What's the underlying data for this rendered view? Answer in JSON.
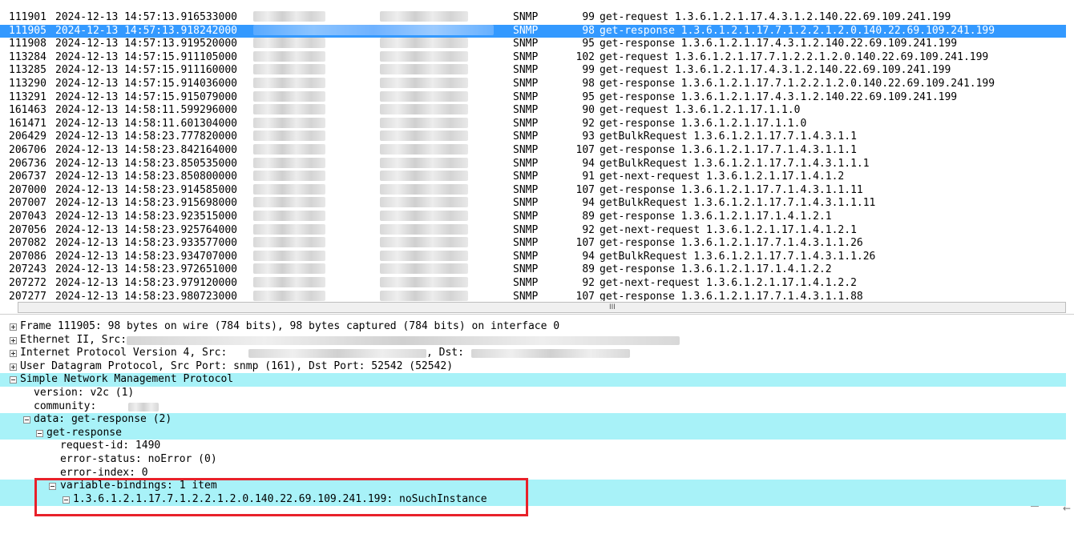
{
  "packets": [
    {
      "no": "111901",
      "time": "2024-12-13 14:57:13.916533000",
      "protocol": "SNMP",
      "length": "99",
      "info": "get-request 1.3.6.1.2.1.17.4.3.1.2.140.22.69.109.241.199"
    },
    {
      "no": "111905",
      "time": "2024-12-13 14:57:13.918242000",
      "protocol": "SNMP",
      "length": "98",
      "info": "get-response 1.3.6.1.2.1.17.7.1.2.2.1.2.0.140.22.69.109.241.199",
      "selected": true
    },
    {
      "no": "111908",
      "time": "2024-12-13 14:57:13.919520000",
      "protocol": "SNMP",
      "length": "95",
      "info": "get-response 1.3.6.1.2.1.17.4.3.1.2.140.22.69.109.241.199"
    },
    {
      "no": "113284",
      "time": "2024-12-13 14:57:15.911105000",
      "protocol": "SNMP",
      "length": "102",
      "info": "get-request 1.3.6.1.2.1.17.7.1.2.2.1.2.0.140.22.69.109.241.199"
    },
    {
      "no": "113285",
      "time": "2024-12-13 14:57:15.911160000",
      "protocol": "SNMP",
      "length": "99",
      "info": "get-request 1.3.6.1.2.1.17.4.3.1.2.140.22.69.109.241.199"
    },
    {
      "no": "113290",
      "time": "2024-12-13 14:57:15.914036000",
      "protocol": "SNMP",
      "length": "98",
      "info": "get-response 1.3.6.1.2.1.17.7.1.2.2.1.2.0.140.22.69.109.241.199"
    },
    {
      "no": "113291",
      "time": "2024-12-13 14:57:15.915079000",
      "protocol": "SNMP",
      "length": "95",
      "info": "get-response 1.3.6.1.2.1.17.4.3.1.2.140.22.69.109.241.199"
    },
    {
      "no": "161463",
      "time": "2024-12-13 14:58:11.599296000",
      "protocol": "SNMP",
      "length": "90",
      "info": "get-request 1.3.6.1.2.1.17.1.1.0"
    },
    {
      "no": "161471",
      "time": "2024-12-13 14:58:11.601304000",
      "protocol": "SNMP",
      "length": "92",
      "info": "get-response 1.3.6.1.2.1.17.1.1.0"
    },
    {
      "no": "206429",
      "time": "2024-12-13 14:58:23.777820000",
      "protocol": "SNMP",
      "length": "93",
      "info": "getBulkRequest 1.3.6.1.2.1.17.7.1.4.3.1.1"
    },
    {
      "no": "206706",
      "time": "2024-12-13 14:58:23.842164000",
      "protocol": "SNMP",
      "length": "107",
      "info": "get-response 1.3.6.1.2.1.17.7.1.4.3.1.1.1"
    },
    {
      "no": "206736",
      "time": "2024-12-13 14:58:23.850535000",
      "protocol": "SNMP",
      "length": "94",
      "info": "getBulkRequest 1.3.6.1.2.1.17.7.1.4.3.1.1.1"
    },
    {
      "no": "206737",
      "time": "2024-12-13 14:58:23.850800000",
      "protocol": "SNMP",
      "length": "91",
      "info": "get-next-request 1.3.6.1.2.1.17.1.4.1.2"
    },
    {
      "no": "207000",
      "time": "2024-12-13 14:58:23.914585000",
      "protocol": "SNMP",
      "length": "107",
      "info": "get-response 1.3.6.1.2.1.17.7.1.4.3.1.1.11"
    },
    {
      "no": "207007",
      "time": "2024-12-13 14:58:23.915698000",
      "protocol": "SNMP",
      "length": "94",
      "info": "getBulkRequest 1.3.6.1.2.1.17.7.1.4.3.1.1.11"
    },
    {
      "no": "207043",
      "time": "2024-12-13 14:58:23.923515000",
      "protocol": "SNMP",
      "length": "89",
      "info": "get-response 1.3.6.1.2.1.17.1.4.1.2.1"
    },
    {
      "no": "207056",
      "time": "2024-12-13 14:58:23.925764000",
      "protocol": "SNMP",
      "length": "92",
      "info": "get-next-request 1.3.6.1.2.1.17.1.4.1.2.1"
    },
    {
      "no": "207082",
      "time": "2024-12-13 14:58:23.933577000",
      "protocol": "SNMP",
      "length": "107",
      "info": "get-response 1.3.6.1.2.1.17.7.1.4.3.1.1.26"
    },
    {
      "no": "207086",
      "time": "2024-12-13 14:58:23.934707000",
      "protocol": "SNMP",
      "length": "94",
      "info": "getBulkRequest 1.3.6.1.2.1.17.7.1.4.3.1.1.26"
    },
    {
      "no": "207243",
      "time": "2024-12-13 14:58:23.972651000",
      "protocol": "SNMP",
      "length": "89",
      "info": "get-response 1.3.6.1.2.1.17.1.4.1.2.2"
    },
    {
      "no": "207272",
      "time": "2024-12-13 14:58:23.979120000",
      "protocol": "SNMP",
      "length": "92",
      "info": "get-next-request 1.3.6.1.2.1.17.1.4.1.2.2"
    },
    {
      "no": "207277",
      "time": "2024-12-13 14:58:23.980723000",
      "protocol": "SNMP",
      "length": "107",
      "info": "get-response 1.3.6.1.2.1.17.7.1.4.3.1.1.88"
    }
  ],
  "scrollbar": {
    "grip": "III"
  },
  "details": {
    "frame": "Frame 111905: 98 bytes on wire (784 bits), 98 bytes captured (784 bits) on interface 0",
    "ethernet": "Ethernet II, Src:",
    "ip_src": "Internet Protocol Version 4, Src:",
    "ip_dst": ", Dst:",
    "udp": "User Datagram Protocol, Src Port: snmp (161), Dst Port: 52542 (52542)",
    "snmp": "Simple Network Management Protocol",
    "version": "version: v2c (1)",
    "community": "community:",
    "data": "data: get-response (2)",
    "get_response": "get-response",
    "request_id": "request-id: 1490",
    "error_status": "error-status: noError (0)",
    "error_index": "error-index: 0",
    "variable_bindings": "variable-bindings: 1 item",
    "binding": "1.3.6.1.2.1.17.7.1.2.2.1.2.0.140.22.69.109.241.199: noSuchInstance"
  },
  "colors": {
    "selection": "#3399ff",
    "tree_highlight": "#a8f2f8",
    "annotation_box": "#e8212a"
  }
}
